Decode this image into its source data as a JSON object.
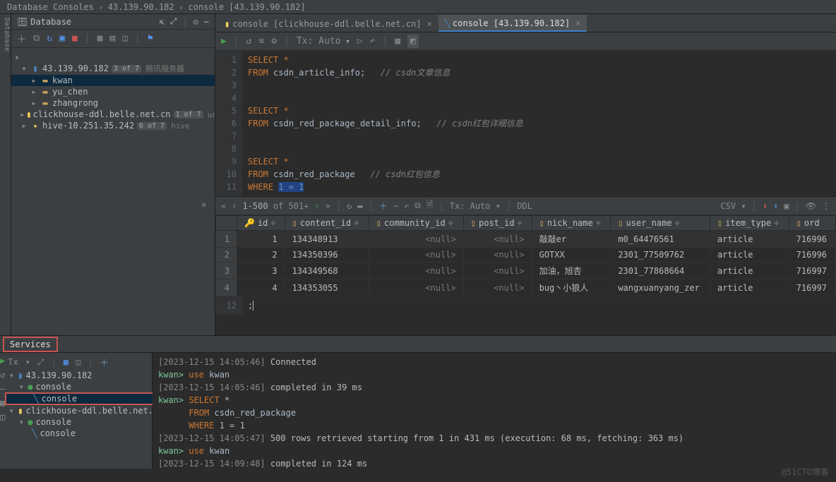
{
  "breadcrumb": {
    "p1": "Database Consoles",
    "p2": "43.139.90.182",
    "p3": "console [43.139.90.182]"
  },
  "left_strip": "Database",
  "db": {
    "title": "Database",
    "root": {
      "label": "43.139.90.182",
      "count": "3 of 7",
      "tag": "腾讯服务器"
    },
    "kids": [
      {
        "label": "kwan"
      },
      {
        "label": "yu_chen"
      },
      {
        "label": "zhangrong"
      }
    ],
    "ck": {
      "label": "clickhouse-ddl.belle.net.cn",
      "count": "1 of 7",
      "tag": "uat-ck"
    },
    "hive": {
      "label": "hive-10.251.35.242",
      "count": "6 of 7",
      "tag": "hive"
    }
  },
  "tabs": {
    "t1": "console [clickhouse-ddl.belle.net.cn]",
    "t2": "console [43.139.90.182]"
  },
  "ed_toolbar": {
    "tx": "Tx: Auto"
  },
  "code_lines": [
    "1",
    "2",
    "3",
    "4",
    "5",
    "6",
    "7",
    "8",
    "9",
    "10",
    "11"
  ],
  "sql": {
    "l1": {
      "select": "SELECT",
      "star": "*"
    },
    "l2": {
      "from": "FROM",
      "tbl": "csdn_article_info",
      "semi": ";",
      "cmt": "// csdn文章信息"
    },
    "l5": {
      "select": "SELECT",
      "star": "*"
    },
    "l6": {
      "from": "FROM",
      "tbl": "csdn_red_package_detail_info",
      "semi": ";",
      "cmt": "// csdn红包详细信息"
    },
    "l9": {
      "select": "SELECT",
      "star": "*"
    },
    "l10": {
      "from": "FROM",
      "tbl": "csdn_red_package",
      "cmt": "// csdn红包信息"
    },
    "l11": {
      "where": "WHERE",
      "cond": "1 = 1"
    },
    "l12_num": "12",
    "l12": ";"
  },
  "res_toolbar": {
    "page": "1-500",
    "of": "of 501+",
    "tx": "Tx: Auto",
    "ddl": "DDL",
    "csv": "CSV"
  },
  "grid": {
    "cols": [
      "id",
      "content_id",
      "community_id",
      "post_id",
      "nick_name",
      "user_name",
      "item_type",
      "ord"
    ],
    "rows": [
      {
        "n": "1",
        "id": "1",
        "content_id": "134348913",
        "community_id": "<null>",
        "post_id": "<null>",
        "nick_name": "敲敲er",
        "user_name": "m0_64476561",
        "item_type": "article",
        "ord": "716996"
      },
      {
        "n": "2",
        "id": "2",
        "content_id": "134350396",
        "community_id": "<null>",
        "post_id": "<null>",
        "nick_name": "GOTXX",
        "user_name": "2301_77509762",
        "item_type": "article",
        "ord": "716996"
      },
      {
        "n": "3",
        "id": "3",
        "content_id": "134349568",
        "community_id": "<null>",
        "post_id": "<null>",
        "nick_name": "加油，旭杏",
        "user_name": "2301_77868664",
        "item_type": "article",
        "ord": "716997"
      },
      {
        "n": "4",
        "id": "4",
        "content_id": "134353055",
        "community_id": "<null>",
        "post_id": "<null>",
        "nick_name": "bug丶小狼人",
        "user_name": "wangxuanyang_zer",
        "item_type": "article",
        "ord": "716997"
      }
    ]
  },
  "services": {
    "label": "Services",
    "tx": "Tx"
  },
  "svc_tree": {
    "r1": "43.139.90.182",
    "r2": "console",
    "r3": "console",
    "r4": "clickhouse-ddl.belle.net.cn",
    "r5": "console",
    "r6": "console"
  },
  "log": {
    "l1": {
      "ts": "[2023-12-15 14:05:46]",
      "msg": "Connected"
    },
    "l2": {
      "prompt": "kwan>",
      "kw": "use",
      "id": "kwan"
    },
    "l3": {
      "ts": "[2023-12-15 14:05:46]",
      "msg": "completed in 39 ms"
    },
    "l4": {
      "prompt": "kwan>",
      "kw": "SELECT",
      "star": "*"
    },
    "l5": {
      "kw": "FROM",
      "id": "csdn_red_package"
    },
    "l6": {
      "kw": "WHERE",
      "id": "1 = 1"
    },
    "l7": {
      "ts": "[2023-12-15 14:05:47]",
      "msg": "500 rows retrieved starting from 1 in 431 ms (execution: 68 ms, fetching: 363 ms)"
    },
    "l8": {
      "prompt": "kwan>",
      "kw": "use",
      "id": "kwan"
    },
    "l9": {
      "ts": "[2023-12-15 14:09:48]",
      "msg": "completed in 124 ms"
    }
  },
  "watermark": "@51CTO博客"
}
